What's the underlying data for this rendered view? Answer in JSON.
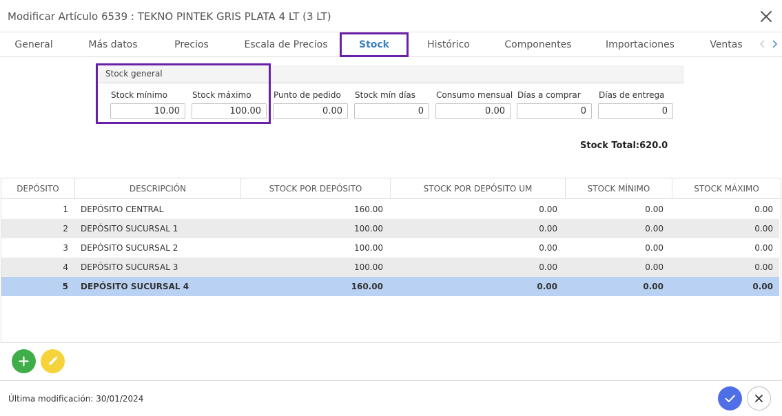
{
  "header": {
    "title": "Modificar Artículo 6539 : TEKNO PINTEK GRIS PLATA 4 LT (3 LT)"
  },
  "tabs": [
    {
      "label": "General"
    },
    {
      "label": "Más datos"
    },
    {
      "label": "Precios"
    },
    {
      "label": "Escala de Precios"
    },
    {
      "label": "Stock"
    },
    {
      "label": "Histórico"
    },
    {
      "label": "Componentes"
    },
    {
      "label": "Importaciones"
    },
    {
      "label": "Ventas"
    }
  ],
  "active_tab": "Stock",
  "stock_general": {
    "title": "Stock general",
    "fields": [
      {
        "label": "Stock mínimo",
        "value": "10.00"
      },
      {
        "label": "Stock máximo",
        "value": "100.00"
      },
      {
        "label": "Punto de pedido",
        "value": "0.00"
      },
      {
        "label": "Stock mín días",
        "value": "0"
      },
      {
        "label": "Consumo mensual",
        "value": "0.00"
      },
      {
        "label": "Días a comprar",
        "value": "0"
      },
      {
        "label": "Días de entrega",
        "value": "0"
      }
    ],
    "stock_total": "Stock Total:620.0"
  },
  "table": {
    "columns": [
      "DEPÓSITO",
      "DESCRIPCIÓN",
      "STOCK POR DEPÓSITO",
      "STOCK POR DEPÓSITO UM",
      "STOCK MÍNIMO",
      "STOCK MÁXIMO"
    ],
    "rows": [
      {
        "deposito": "1",
        "descripcion": "DEPÓSITO CENTRAL",
        "stock": "160.00",
        "stock_um": "0.00",
        "minimo": "0.00",
        "maximo": "0.00"
      },
      {
        "deposito": "2",
        "descripcion": "DEPÓSITO SUCURSAL 1",
        "stock": "100.00",
        "stock_um": "0.00",
        "minimo": "0.00",
        "maximo": "0.00"
      },
      {
        "deposito": "3",
        "descripcion": "DEPÓSITO SUCURSAL 2",
        "stock": "100.00",
        "stock_um": "0.00",
        "minimo": "0.00",
        "maximo": "0.00"
      },
      {
        "deposito": "4",
        "descripcion": "DEPÓSITO SUCURSAL 3",
        "stock": "100.00",
        "stock_um": "0.00",
        "minimo": "0.00",
        "maximo": "0.00"
      },
      {
        "deposito": "5",
        "descripcion": "DEPÓSITO SUCURSAL 4",
        "stock": "160.00",
        "stock_um": "0.00",
        "minimo": "0.00",
        "maximo": "0.00"
      }
    ],
    "selected_row": 5
  },
  "footer": {
    "last_modified": "Última modificación: 30/01/2024"
  },
  "icons": {
    "close": "close-icon",
    "add": "plus-icon",
    "edit": "pencil-icon",
    "confirm": "check-icon",
    "cancel": "close-icon",
    "tab_prev": "chevron-left-icon",
    "tab_next": "chevron-right-icon"
  },
  "colors": {
    "active_tab": "#3b82c4",
    "highlight_box": "#6a1fa8",
    "selected_row": "#b9d2f3",
    "add_button": "#3fae49",
    "edit_button": "#f6d33a",
    "confirm_button": "#4f6fe6"
  }
}
